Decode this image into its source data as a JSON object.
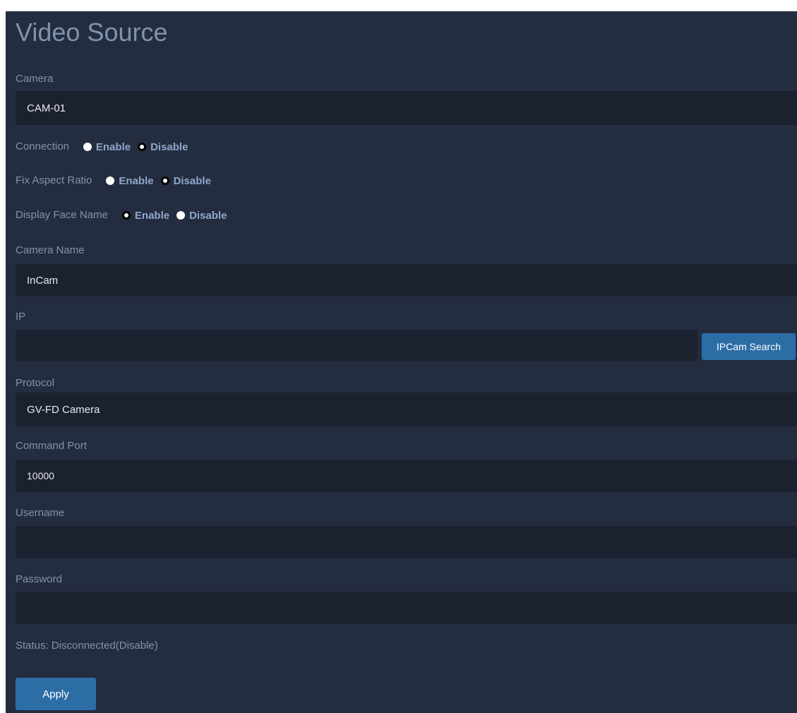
{
  "page": {
    "title": "Video Source"
  },
  "camera": {
    "label": "Camera",
    "value": "CAM-01"
  },
  "connection": {
    "label": "Connection",
    "enable_label": "Enable",
    "disable_label": "Disable",
    "selected": "Disable"
  },
  "fix_aspect_ratio": {
    "label": "Fix Aspect Ratio",
    "enable_label": "Enable",
    "disable_label": "Disable",
    "selected": "Disable"
  },
  "display_face_name": {
    "label": "Display Face Name",
    "enable_label": "Enable",
    "disable_label": "Disable",
    "selected": "Enable"
  },
  "camera_name": {
    "label": "Camera Name",
    "value": "InCam"
  },
  "ip": {
    "label": "IP",
    "value": "",
    "search_button_label": "IPCam Search"
  },
  "protocol": {
    "label": "Protocol",
    "value": "GV-FD Camera"
  },
  "command_port": {
    "label": "Command Port",
    "value": "10000"
  },
  "username": {
    "label": "Username",
    "value": ""
  },
  "password": {
    "label": "Password",
    "value": ""
  },
  "status": {
    "text": "Status: Disconnected(Disable)"
  },
  "actions": {
    "apply_label": "Apply"
  },
  "colors": {
    "background": "#242d3f",
    "field": "#1c2130",
    "label_text": "#7f93ae",
    "radio_text": "#8fa6cb",
    "button": "#2d6da6"
  }
}
